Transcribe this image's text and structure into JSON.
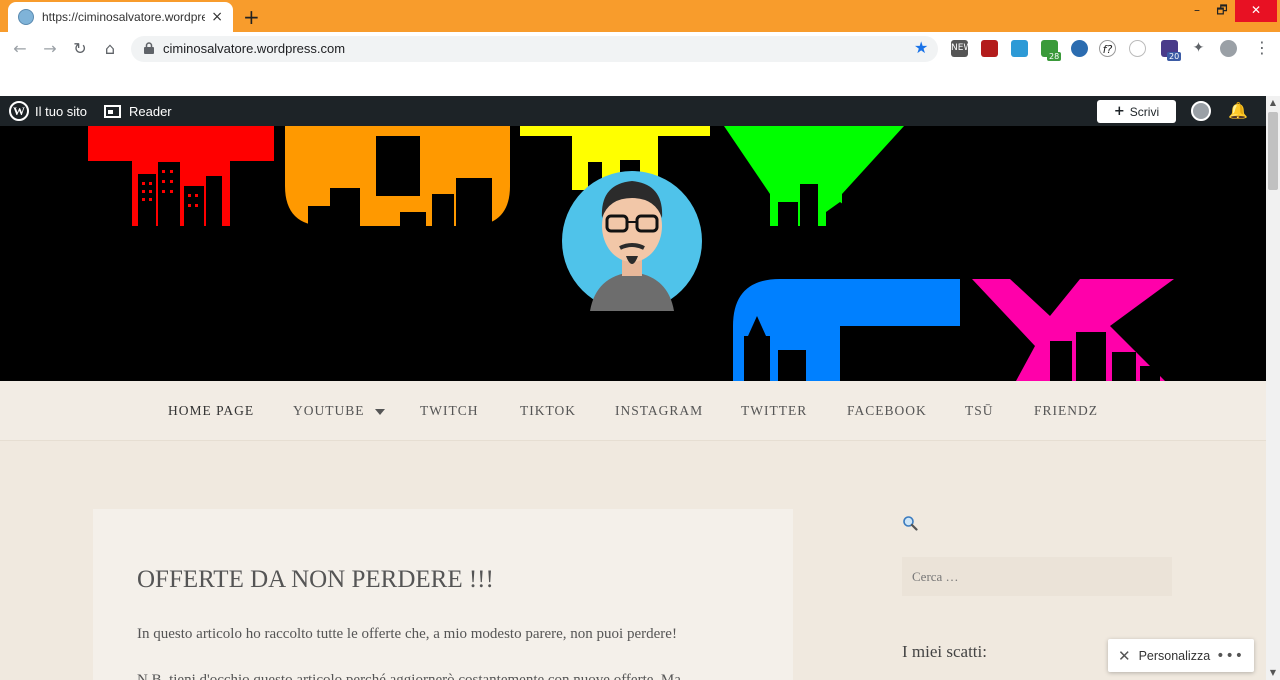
{
  "browser": {
    "tab_title": "https://ciminosalvatore.wordpress.com",
    "tab_close": "×",
    "new_tab": "+",
    "url": "ciminosalvatore.wordpress.com",
    "window_controls": {
      "minimize": "–",
      "maximize": "🗗",
      "close": "✕"
    },
    "back_icon": "←",
    "forward_icon": "→",
    "reload_icon": "↻",
    "home_icon": "⌂",
    "star_icon": "★",
    "menu_icon": "⋮",
    "extensions": [
      {
        "name": "new-extension-icon",
        "label": "NEW",
        "color": "#555555"
      },
      {
        "name": "pdf-extension-icon",
        "label": "",
        "color": "#b31c1c"
      },
      {
        "name": "folder-extension-icon",
        "label": "",
        "color": "#2d9ad6"
      },
      {
        "name": "calendar-extension-icon",
        "label": "28",
        "color": "#3a9a3a"
      },
      {
        "name": "globe-extension-icon",
        "label": "",
        "color": "#2b6cb0"
      },
      {
        "name": "font-extension-icon",
        "label": "f?",
        "color": "#ffffff"
      },
      {
        "name": "eyedropper-extension-icon",
        "label": "",
        "color": "#ffffff"
      },
      {
        "name": "mail-extension-icon",
        "label": "20",
        "color": "#4a3b8a"
      },
      {
        "name": "puzzle-extension-icon",
        "label": "",
        "color": "#ffffff"
      },
      {
        "name": "profile-avatar-icon",
        "label": "",
        "color": "#9aa0a6"
      }
    ],
    "accent_color": "#f89c2c"
  },
  "wpbar": {
    "site_label": "Il tuo sito",
    "reader_label": "Reader",
    "write_label": "Scrivi",
    "write_icon": "+",
    "notification_icon": "🔔",
    "wp_logo_glyph": "W"
  },
  "scrollbar": {
    "up": "▲",
    "down": "▼"
  },
  "nav": {
    "items": [
      {
        "label": "HOME PAGE"
      },
      {
        "label": "YOUTUBE"
      },
      {
        "label": "TWITCH"
      },
      {
        "label": "TIKTOK"
      },
      {
        "label": "INSTAGRAM"
      },
      {
        "label": "TWITTER"
      },
      {
        "label": "FACEBOOK"
      },
      {
        "label": "TSŪ"
      },
      {
        "label": "FRIENDZ"
      }
    ]
  },
  "post": {
    "title": "OFFERTE DA NON PERDERE !!!",
    "excerpt": "In questo articolo ho raccolto tutte le offerte che, a mio modesto parere, non puoi perdere!",
    "cut_line": "N.B. tieni d'occhio questo articolo perché aggiornerò costantemente con nuove offerte. Ma"
  },
  "sidebar": {
    "search_placeholder": "Cerca …",
    "widget_title": "I miei scatti:"
  },
  "personalize": {
    "label": "Personalizza",
    "more": "•••"
  },
  "header_colors": {
    "letter1": "#ff0000",
    "letter2": "#ff9900",
    "letter3": "#ffff00",
    "letter4": "#00ff00",
    "letter5": "#0080ff",
    "letter6": "#ff00aa",
    "avatar_bg": "#4fc3ea"
  }
}
